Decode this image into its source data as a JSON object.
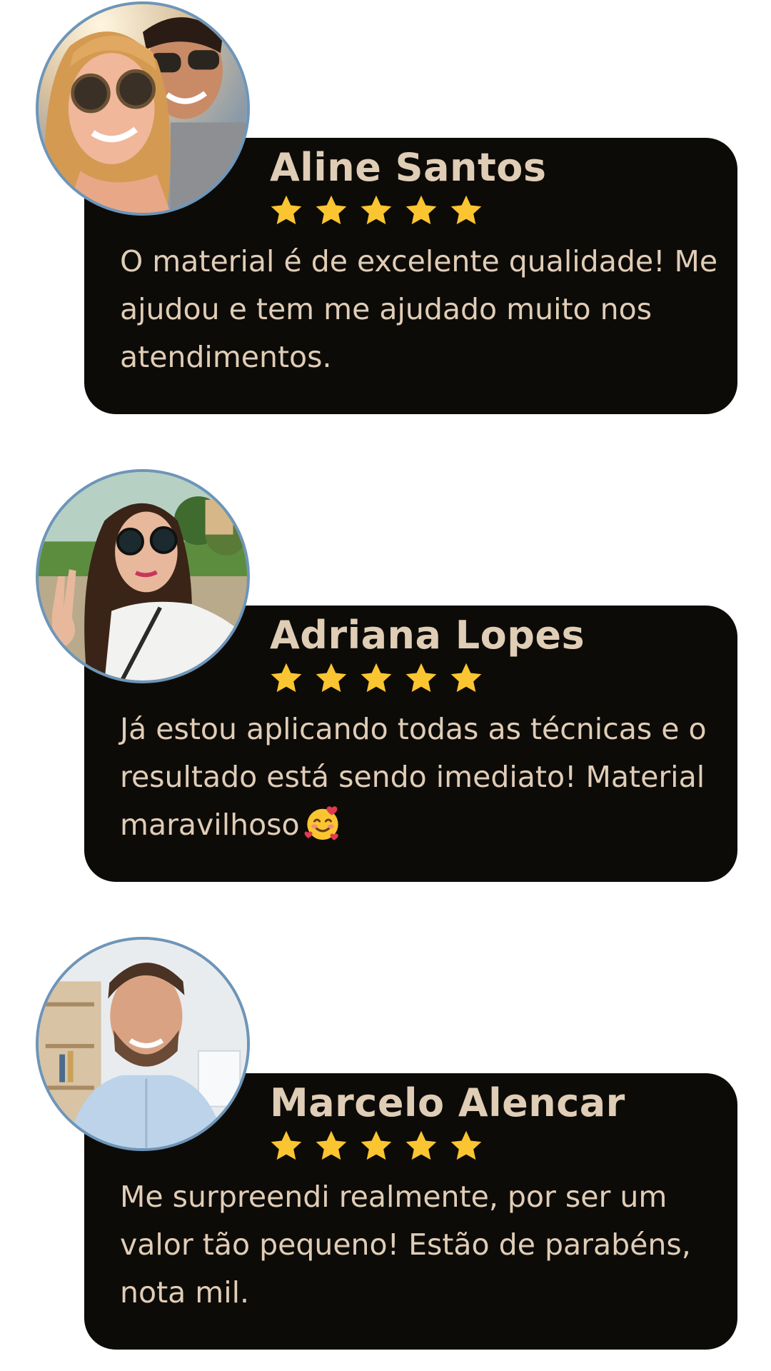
{
  "testimonials": [
    {
      "name": "Aline Santos",
      "rating": 5,
      "review": "O material é de excelente qualidade! Me ajudou e tem me ajudado muito nos atendimentos.",
      "avatar": "couple-selfie-photo"
    },
    {
      "name": "Adriana Lopes",
      "rating": 5,
      "review": "Já estou aplicando todas as técnicas e o resultado está sendo imediato! Material maravilhoso",
      "emoji": "smiling-face-with-hearts-icon",
      "avatar": "woman-peace-sign-photo"
    },
    {
      "name": "Marcelo Alencar",
      "rating": 5,
      "review": "Me surpreendi realmente, por ser um valor tão pequeno! Estão de parabéns, nota mil.",
      "avatar": "smiling-man-photo"
    }
  ],
  "colors": {
    "card_background": "#0d0b08",
    "text": "#e0cdb6",
    "star": "#fbc531",
    "avatar_border": "#6d95b8"
  }
}
